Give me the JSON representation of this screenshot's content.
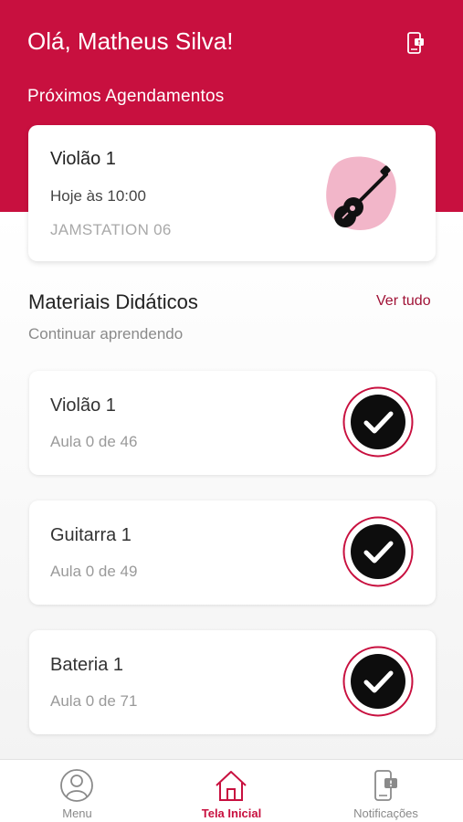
{
  "header": {
    "greeting": "Olá, Matheus Silva!",
    "section_title": "Próximos Agendamentos",
    "notifications_icon": "phone-notification-icon",
    "bg_color": "#c8103f"
  },
  "appointment": {
    "title": "Violão 1",
    "time": "Hoje às 10:00",
    "room": "JAMSTATION 06",
    "illustration": "guitar-icon"
  },
  "materials": {
    "title": "Materiais Didáticos",
    "see_all": "Ver tudo",
    "subtitle": "Continuar aprendendo",
    "courses": [
      {
        "name": "Violão 1",
        "progress": "Aula 0 de 46",
        "icon": "check-circle-icon"
      },
      {
        "name": "Guitarra 1",
        "progress": "Aula 0 de 49",
        "icon": "check-circle-icon"
      },
      {
        "name": "Bateria 1",
        "progress": "Aula 0 de 71",
        "icon": "check-circle-icon"
      }
    ]
  },
  "tabbar": {
    "tabs": [
      {
        "label": "Menu",
        "icon": "user-circle-icon",
        "active": false
      },
      {
        "label": "Tela Inicial",
        "icon": "home-icon",
        "active": true
      },
      {
        "label": "Notificações",
        "icon": "phone-notification-icon",
        "active": false
      }
    ]
  },
  "colors": {
    "accent": "#c8103f",
    "link": "#a01236",
    "badge_pink": "#f2b6c9"
  }
}
